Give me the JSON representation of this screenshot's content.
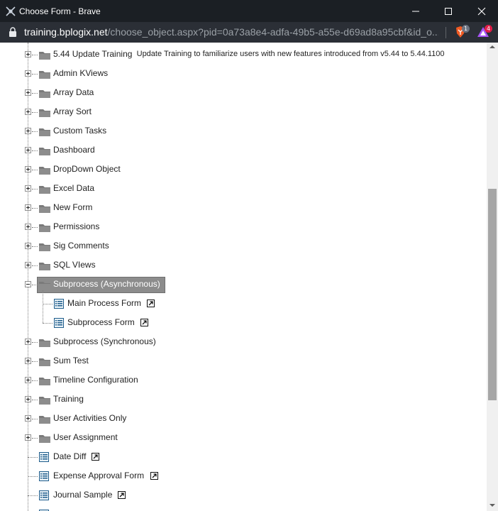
{
  "window": {
    "title": "Choose Form - Brave",
    "minimize_label": "minimize",
    "maximize_label": "maximize",
    "close_label": "close"
  },
  "address_bar": {
    "host": "training.bplogix.net",
    "path": "/choose_object.aspx?pid=0a73a8e4-adfa-49b5-a55e-d69ad8a95cbf&id_o...",
    "shields_count": "1",
    "rewards_count": "4"
  },
  "tree": {
    "folders_top": [
      {
        "label": "5.44 Update Training",
        "desc": "Update Training to familiarize users with new features introduced from v5.44 to 5.44.1100"
      },
      {
        "label": "Admin KViews"
      },
      {
        "label": "Array Data"
      },
      {
        "label": "Array Sort"
      },
      {
        "label": "Custom Tasks"
      },
      {
        "label": "Dashboard"
      },
      {
        "label": "DropDown Object"
      },
      {
        "label": "Excel Data"
      },
      {
        "label": "New Form"
      },
      {
        "label": "Permissions"
      },
      {
        "label": "Sig Comments"
      },
      {
        "label": "SQL VIews"
      }
    ],
    "selected_folder": {
      "label": "Subprocess (Asynchronous)"
    },
    "selected_children": [
      {
        "label": "Main Process Form"
      },
      {
        "label": "Subprocess Form"
      }
    ],
    "folders_bottom": [
      {
        "label": "Subprocess (Synchronous)"
      },
      {
        "label": "Sum Test"
      },
      {
        "label": "Timeline Configuration"
      },
      {
        "label": "Training"
      },
      {
        "label": "User Activities Only"
      },
      {
        "label": "User Assignment"
      }
    ],
    "forms_bottom": [
      {
        "label": "Date Diff"
      },
      {
        "label": "Expense Approval Form"
      },
      {
        "label": "Journal Sample"
      }
    ]
  }
}
